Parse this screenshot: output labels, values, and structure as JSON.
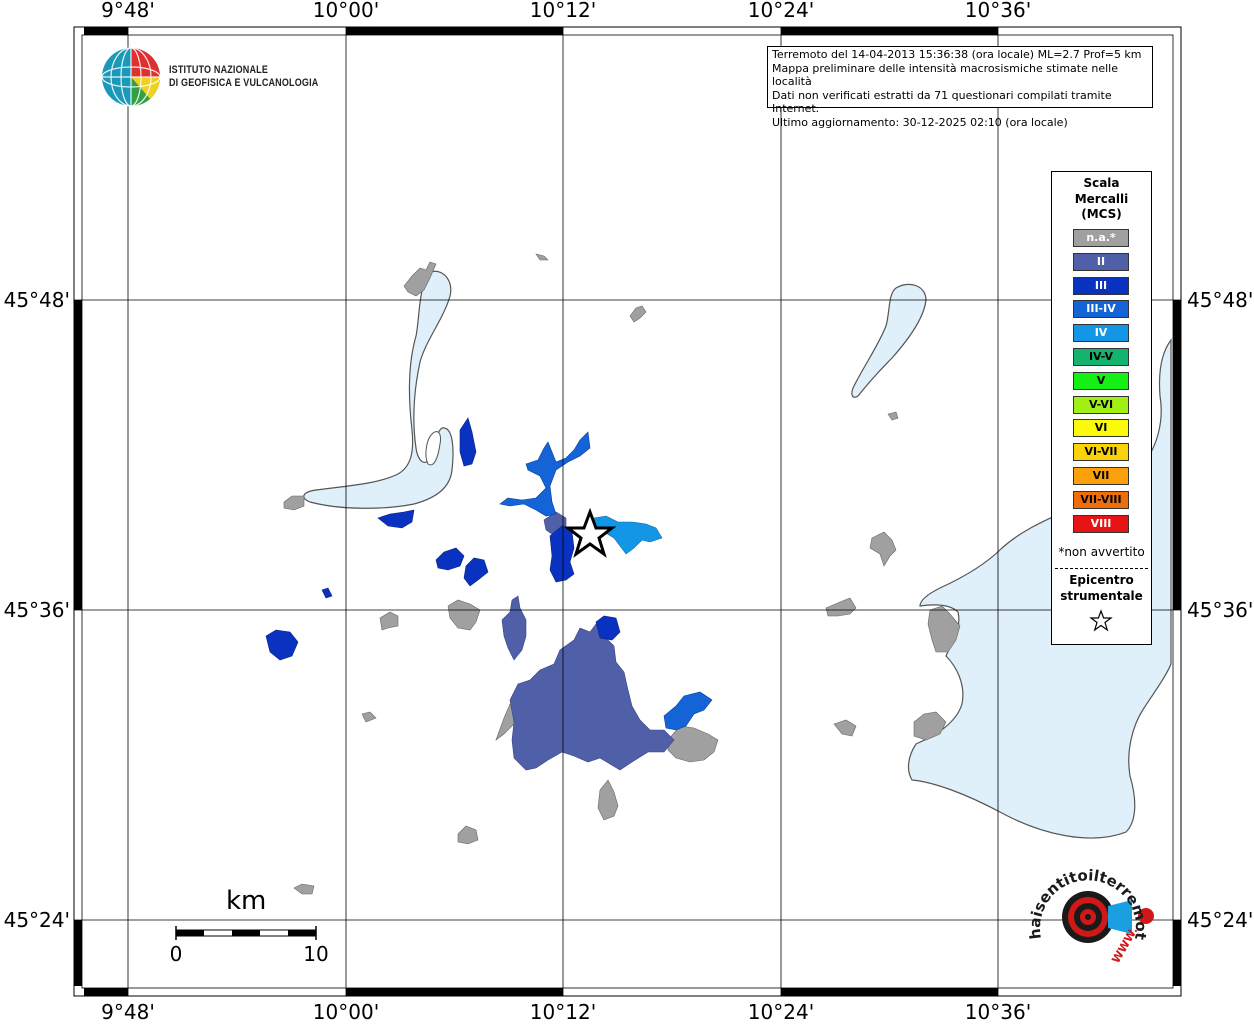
{
  "coordinates": {
    "top": [
      "9°48'",
      "10°00'",
      "10°12'",
      "10°24'",
      "10°36'"
    ],
    "bottom": [
      "9°48'",
      "10°00'",
      "10°12'",
      "10°24'",
      "10°36'"
    ],
    "left": [
      "45°48'",
      "45°36'",
      "45°24'"
    ],
    "right": [
      "45°48'",
      "45°36'",
      "45°24'"
    ]
  },
  "info_box": {
    "line1": "Terremoto del 14-04-2013 15:36:38 (ora locale) ML=2.7 Prof=5 km",
    "line2": "Mappa preliminare delle intensità macrosismiche stimate nelle località",
    "line3": "Dati non verificati estratti da 71 questionari compilati tramite Internet.",
    "line4": "Ultimo aggiornamento: 30-12-2025 02:10 (ora locale)"
  },
  "logo": {
    "line1": "ISTITUTO NAZIONALE",
    "line2": "DI GEOFISICA E VULCANOLOGIA"
  },
  "legend": {
    "title1": "Scala",
    "title2": "Mercalli",
    "title3": "(MCS)",
    "items": [
      {
        "label": "n.a.*",
        "color": "#a0a0a0",
        "text_color": "#ffffff"
      },
      {
        "label": "II",
        "color": "#5060a8",
        "text_color": "#ffffff"
      },
      {
        "label": "III",
        "color": "#0a32c0",
        "text_color": "#ffffff"
      },
      {
        "label": "III-IV",
        "color": "#1464d8",
        "text_color": "#ffffff"
      },
      {
        "label": "IV",
        "color": "#1496e6",
        "text_color": "#ffffff"
      },
      {
        "label": "IV-V",
        "color": "#14b46e",
        "text_color": "#000000"
      },
      {
        "label": "V",
        "color": "#14f014",
        "text_color": "#000000"
      },
      {
        "label": "V-VI",
        "color": "#a0f014",
        "text_color": "#000000"
      },
      {
        "label": "VI",
        "color": "#fafa0a",
        "text_color": "#000000"
      },
      {
        "label": "VI-VII",
        "color": "#fad20a",
        "text_color": "#000000"
      },
      {
        "label": "VII",
        "color": "#faa00a",
        "text_color": "#000000"
      },
      {
        "label": "VII-VIII",
        "color": "#f06e0a",
        "text_color": "#000000"
      },
      {
        "label": "VIII",
        "color": "#e61414",
        "text_color": "#ffffff"
      }
    ],
    "note": "*non avvertito",
    "epicenter1": "Epicentro",
    "epicenter2": "strumentale"
  },
  "scalebar": {
    "unit": "km",
    "start": "0",
    "end": "10"
  },
  "watermark": {
    "text": "haisentitoilterremoto.it",
    "url": "WWW."
  },
  "colors": {
    "lake": "#dff0fa",
    "lake_border": "#555555",
    "na": "#a0a0a0",
    "ii": "#5060a8",
    "iii": "#0a32c0",
    "iii_iv": "#1464d8",
    "iv": "#1496e6"
  }
}
